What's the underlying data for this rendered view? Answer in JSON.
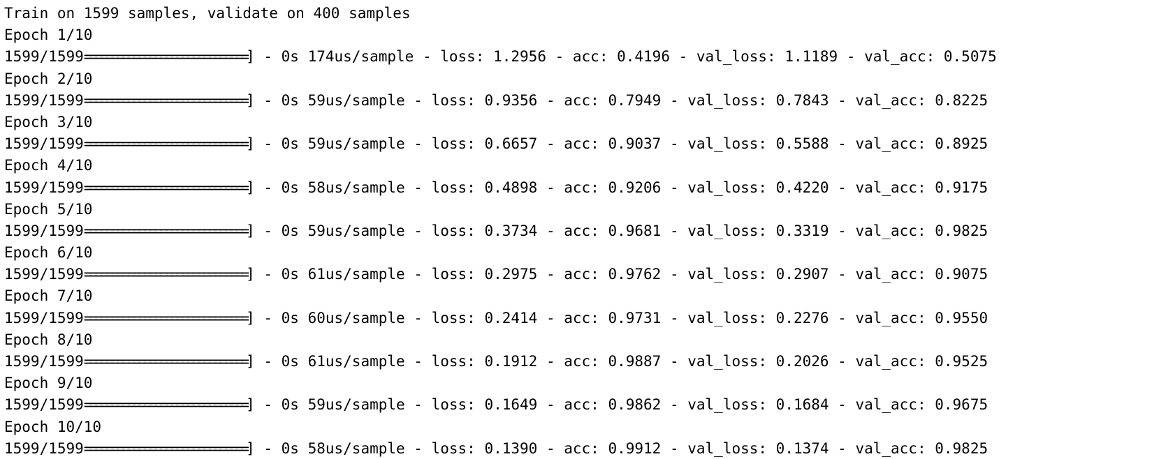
{
  "header": {
    "text": "Train on 1599 samples, validate on 400 samples"
  },
  "epochs": [
    {
      "label": "Epoch 1/10",
      "progress": "1599/1599",
      "bar": "==============================]",
      "stats": " - 0s 174us/sample - loss: 1.2956 - acc: 0.4196 - val_loss: 1.1189 - val_acc: 0.5075"
    },
    {
      "label": "Epoch 2/10",
      "progress": "1599/1599",
      "bar": "==============================]",
      "stats": " - 0s 59us/sample - loss: 0.9356 - acc: 0.7949 - val_loss: 0.7843 - val_acc: 0.8225"
    },
    {
      "label": "Epoch 3/10",
      "progress": "1599/1599",
      "bar": "==============================]",
      "stats": " - 0s 59us/sample - loss: 0.6657 - acc: 0.9037 - val_loss: 0.5588 - val_acc: 0.8925"
    },
    {
      "label": "Epoch 4/10",
      "progress": "1599/1599",
      "bar": "==============================]",
      "stats": " - 0s 58us/sample - loss: 0.4898 - acc: 0.9206 - val_loss: 0.4220 - val_acc: 0.9175"
    },
    {
      "label": "Epoch 5/10",
      "progress": "1599/1599",
      "bar": "==============================]",
      "stats": " - 0s 59us/sample - loss: 0.3734 - acc: 0.9681 - val_loss: 0.3319 - val_acc: 0.9825"
    },
    {
      "label": "Epoch 6/10",
      "progress": "1599/1599",
      "bar": "==============================]",
      "stats": " - 0s 61us/sample - loss: 0.2975 - acc: 0.9762 - val_loss: 0.2907 - val_acc: 0.9075"
    },
    {
      "label": "Epoch 7/10",
      "progress": "1599/1599",
      "bar": "==============================]",
      "stats": " - 0s 60us/sample - loss: 0.2414 - acc: 0.9731 - val_loss: 0.2276 - val_acc: 0.9550"
    },
    {
      "label": "Epoch 8/10",
      "progress": "1599/1599",
      "bar": "==============================]",
      "stats": " - 0s 61us/sample - loss: 0.1912 - acc: 0.9887 - val_loss: 0.2026 - val_acc: 0.9525"
    },
    {
      "label": "Epoch 9/10",
      "progress": "1599/1599",
      "bar": "==============================]",
      "stats": " - 0s 59us/sample - loss: 0.1649 - acc: 0.9862 - val_loss: 0.1684 - val_acc: 0.9675"
    },
    {
      "label": "Epoch 10/10",
      "progress": "1599/1599",
      "bar": "==============================]",
      "stats": " - 0s 58us/sample - loss: 0.1390 - acc: 0.9912 - val_loss: 0.1374 - val_acc: 0.9825"
    }
  ]
}
